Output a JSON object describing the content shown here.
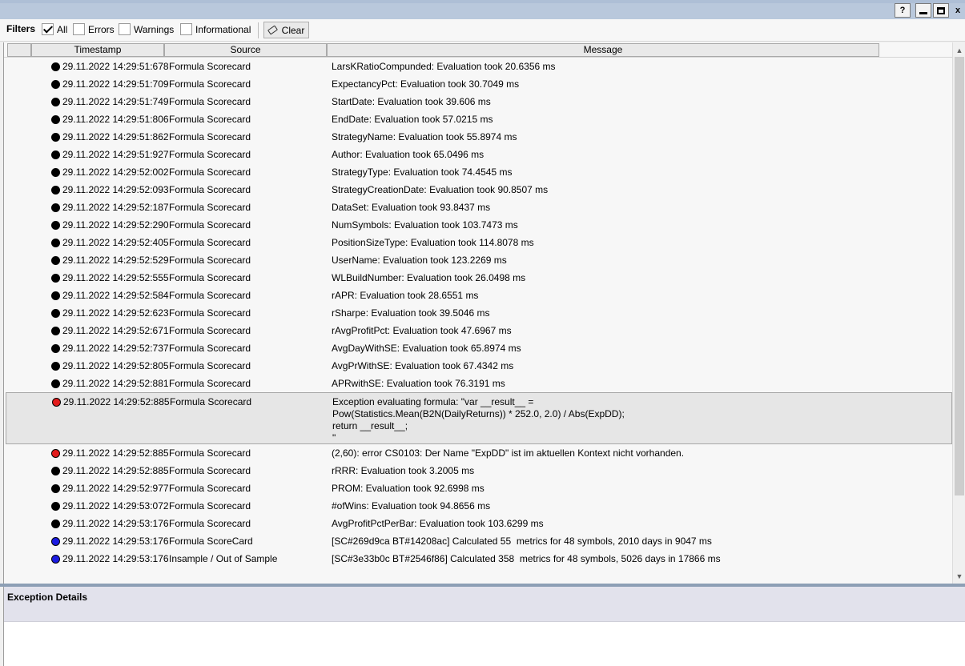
{
  "window": {
    "help_label": "?",
    "close_label": "x"
  },
  "toolbar": {
    "filters_label": "Filters",
    "filters": [
      {
        "label": "All",
        "checked": true
      },
      {
        "label": "Errors",
        "checked": false
      },
      {
        "label": "Warnings",
        "checked": false
      },
      {
        "label": "Informational",
        "checked": false
      }
    ],
    "clear_label": "Clear"
  },
  "grid": {
    "columns": {
      "timestamp": "Timestamp",
      "source": "Source",
      "message": "Message"
    },
    "rows": [
      {
        "level": "normal",
        "timestamp": "29.11.2022 14:29:51:678",
        "source": "Formula Scorecard",
        "message": "LarsKRatioCompunded: Evaluation took 20.6356 ms"
      },
      {
        "level": "normal",
        "timestamp": "29.11.2022 14:29:51:709",
        "source": "Formula Scorecard",
        "message": "ExpectancyPct: Evaluation took 30.7049 ms"
      },
      {
        "level": "normal",
        "timestamp": "29.11.2022 14:29:51:749",
        "source": "Formula Scorecard",
        "message": "StartDate: Evaluation took 39.606 ms"
      },
      {
        "level": "normal",
        "timestamp": "29.11.2022 14:29:51:806",
        "source": "Formula Scorecard",
        "message": "EndDate: Evaluation took 57.0215 ms"
      },
      {
        "level": "normal",
        "timestamp": "29.11.2022 14:29:51:862",
        "source": "Formula Scorecard",
        "message": "StrategyName: Evaluation took 55.8974 ms"
      },
      {
        "level": "normal",
        "timestamp": "29.11.2022 14:29:51:927",
        "source": "Formula Scorecard",
        "message": "Author: Evaluation took 65.0496 ms"
      },
      {
        "level": "normal",
        "timestamp": "29.11.2022 14:29:52:002",
        "source": "Formula Scorecard",
        "message": "StrategyType: Evaluation took 74.4545 ms"
      },
      {
        "level": "normal",
        "timestamp": "29.11.2022 14:29:52:093",
        "source": "Formula Scorecard",
        "message": "StrategyCreationDate: Evaluation took 90.8507 ms"
      },
      {
        "level": "normal",
        "timestamp": "29.11.2022 14:29:52:187",
        "source": "Formula Scorecard",
        "message": "DataSet: Evaluation took 93.8437 ms"
      },
      {
        "level": "normal",
        "timestamp": "29.11.2022 14:29:52:290",
        "source": "Formula Scorecard",
        "message": "NumSymbols: Evaluation took 103.7473 ms"
      },
      {
        "level": "normal",
        "timestamp": "29.11.2022 14:29:52:405",
        "source": "Formula Scorecard",
        "message": "PositionSizeType: Evaluation took 114.8078 ms"
      },
      {
        "level": "normal",
        "timestamp": "29.11.2022 14:29:52:529",
        "source": "Formula Scorecard",
        "message": "UserName: Evaluation took 123.2269 ms"
      },
      {
        "level": "normal",
        "timestamp": "29.11.2022 14:29:52:555",
        "source": "Formula Scorecard",
        "message": "WLBuildNumber: Evaluation took 26.0498 ms"
      },
      {
        "level": "normal",
        "timestamp": "29.11.2022 14:29:52:584",
        "source": "Formula Scorecard",
        "message": "rAPR: Evaluation took 28.6551 ms"
      },
      {
        "level": "normal",
        "timestamp": "29.11.2022 14:29:52:623",
        "source": "Formula Scorecard",
        "message": "rSharpe: Evaluation took 39.5046 ms"
      },
      {
        "level": "normal",
        "timestamp": "29.11.2022 14:29:52:671",
        "source": "Formula Scorecard",
        "message": "rAvgProfitPct: Evaluation took 47.6967 ms"
      },
      {
        "level": "normal",
        "timestamp": "29.11.2022 14:29:52:737",
        "source": "Formula Scorecard",
        "message": "AvgDayWithSE: Evaluation took 65.8974 ms"
      },
      {
        "level": "normal",
        "timestamp": "29.11.2022 14:29:52:805",
        "source": "Formula Scorecard",
        "message": "AvgPrWithSE: Evaluation took 67.4342 ms"
      },
      {
        "level": "normal",
        "timestamp": "29.11.2022 14:29:52:881",
        "source": "Formula Scorecard",
        "message": "APRwithSE: Evaluation took 76.3191 ms"
      },
      {
        "level": "error",
        "expanded": true,
        "timestamp": "29.11.2022 14:29:52:885",
        "source": "Formula Scorecard",
        "message": "Exception evaluating formula: \"var __result__ =\nPow(Statistics.Mean(B2N(DailyReturns)) * 252.0, 2.0) / Abs(ExpDD);\nreturn __result__;\n\""
      },
      {
        "level": "error",
        "timestamp": "29.11.2022 14:29:52:885",
        "source": "Formula Scorecard",
        "message": "(2,60): error CS0103: Der Name \"ExpDD\" ist im aktuellen Kontext nicht vorhanden."
      },
      {
        "level": "normal",
        "timestamp": "29.11.2022 14:29:52:885",
        "source": "Formula Scorecard",
        "message": "rRRR: Evaluation took 3.2005 ms"
      },
      {
        "level": "normal",
        "timestamp": "29.11.2022 14:29:52:977",
        "source": "Formula Scorecard",
        "message": "PROM: Evaluation took 92.6998 ms"
      },
      {
        "level": "normal",
        "timestamp": "29.11.2022 14:29:53:072",
        "source": "Formula Scorecard",
        "message": "#ofWins: Evaluation took 94.8656 ms"
      },
      {
        "level": "normal",
        "timestamp": "29.11.2022 14:29:53:176",
        "source": "Formula Scorecard",
        "message": "AvgProfitPctPerBar: Evaluation took 103.6299 ms"
      },
      {
        "level": "info",
        "timestamp": "29.11.2022 14:29:53:176",
        "source": "Formula ScoreCard",
        "message": "[SC#269d9ca BT#14208ac] Calculated 55  metrics for 48 symbols, 2010 days in 9047 ms"
      },
      {
        "level": "info",
        "timestamp": "29.11.2022 14:29:53:176",
        "source": "Insample / Out of Sample",
        "message": "[SC#3e33b0c BT#2546f86] Calculated 358  metrics for 48 symbols, 5026 days in 17866 ms"
      }
    ]
  },
  "details": {
    "title": "Exception Details"
  }
}
